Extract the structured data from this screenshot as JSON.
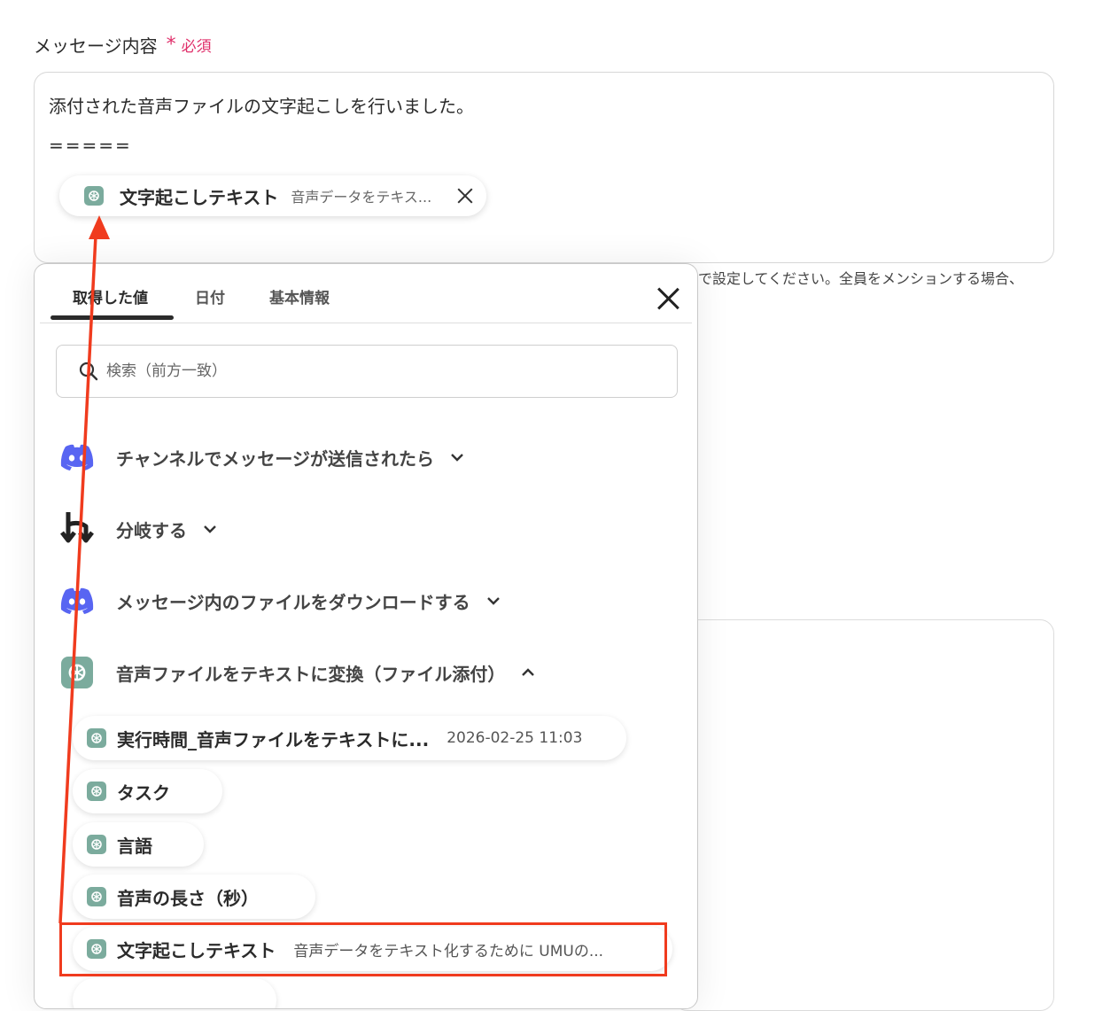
{
  "field": {
    "label": "メッセージ内容",
    "required_star": "*",
    "required_text": "必須"
  },
  "message": {
    "line1": "添付された音声ファイルの文字起こしを行いました。",
    "line2": "=====",
    "chip": {
      "title": "文字起こしテキスト",
      "subtitle": "音声データをテキス..."
    }
  },
  "helper_text": "で設定してください。全員をメンションする場合、",
  "popup": {
    "tabs": [
      {
        "label": "取得した値"
      },
      {
        "label": "日付"
      },
      {
        "label": "基本情報"
      }
    ],
    "search": {
      "placeholder": "検索（前方一致）"
    },
    "sections": [
      {
        "title": "チャンネルでメッセージが送信されたら",
        "icon": "discord-icon",
        "expanded": false
      },
      {
        "title": "分岐する",
        "icon": "branch-icon",
        "expanded": false
      },
      {
        "title": "メッセージ内のファイルをダウンロードする",
        "icon": "discord-icon",
        "expanded": false
      },
      {
        "title": "音声ファイルをテキストに変換（ファイル添付）",
        "icon": "openai-icon",
        "expanded": true
      }
    ],
    "items": [
      {
        "title": "実行時間_音声ファイルをテキストに...",
        "subtitle": "2026-02-25 11:03"
      },
      {
        "title": "タスク",
        "subtitle": ""
      },
      {
        "title": "言語",
        "subtitle": ""
      },
      {
        "title": "音声の長さ（秒）",
        "subtitle": ""
      },
      {
        "title": "文字起こしテキスト",
        "subtitle": "音声データをテキスト化するために UMUの..."
      }
    ]
  },
  "colors": {
    "accent_required": "#e0306b",
    "highlight": "#f03b1e",
    "openai_icon_bg": "#7bab9d",
    "discord": "#5865f2"
  }
}
